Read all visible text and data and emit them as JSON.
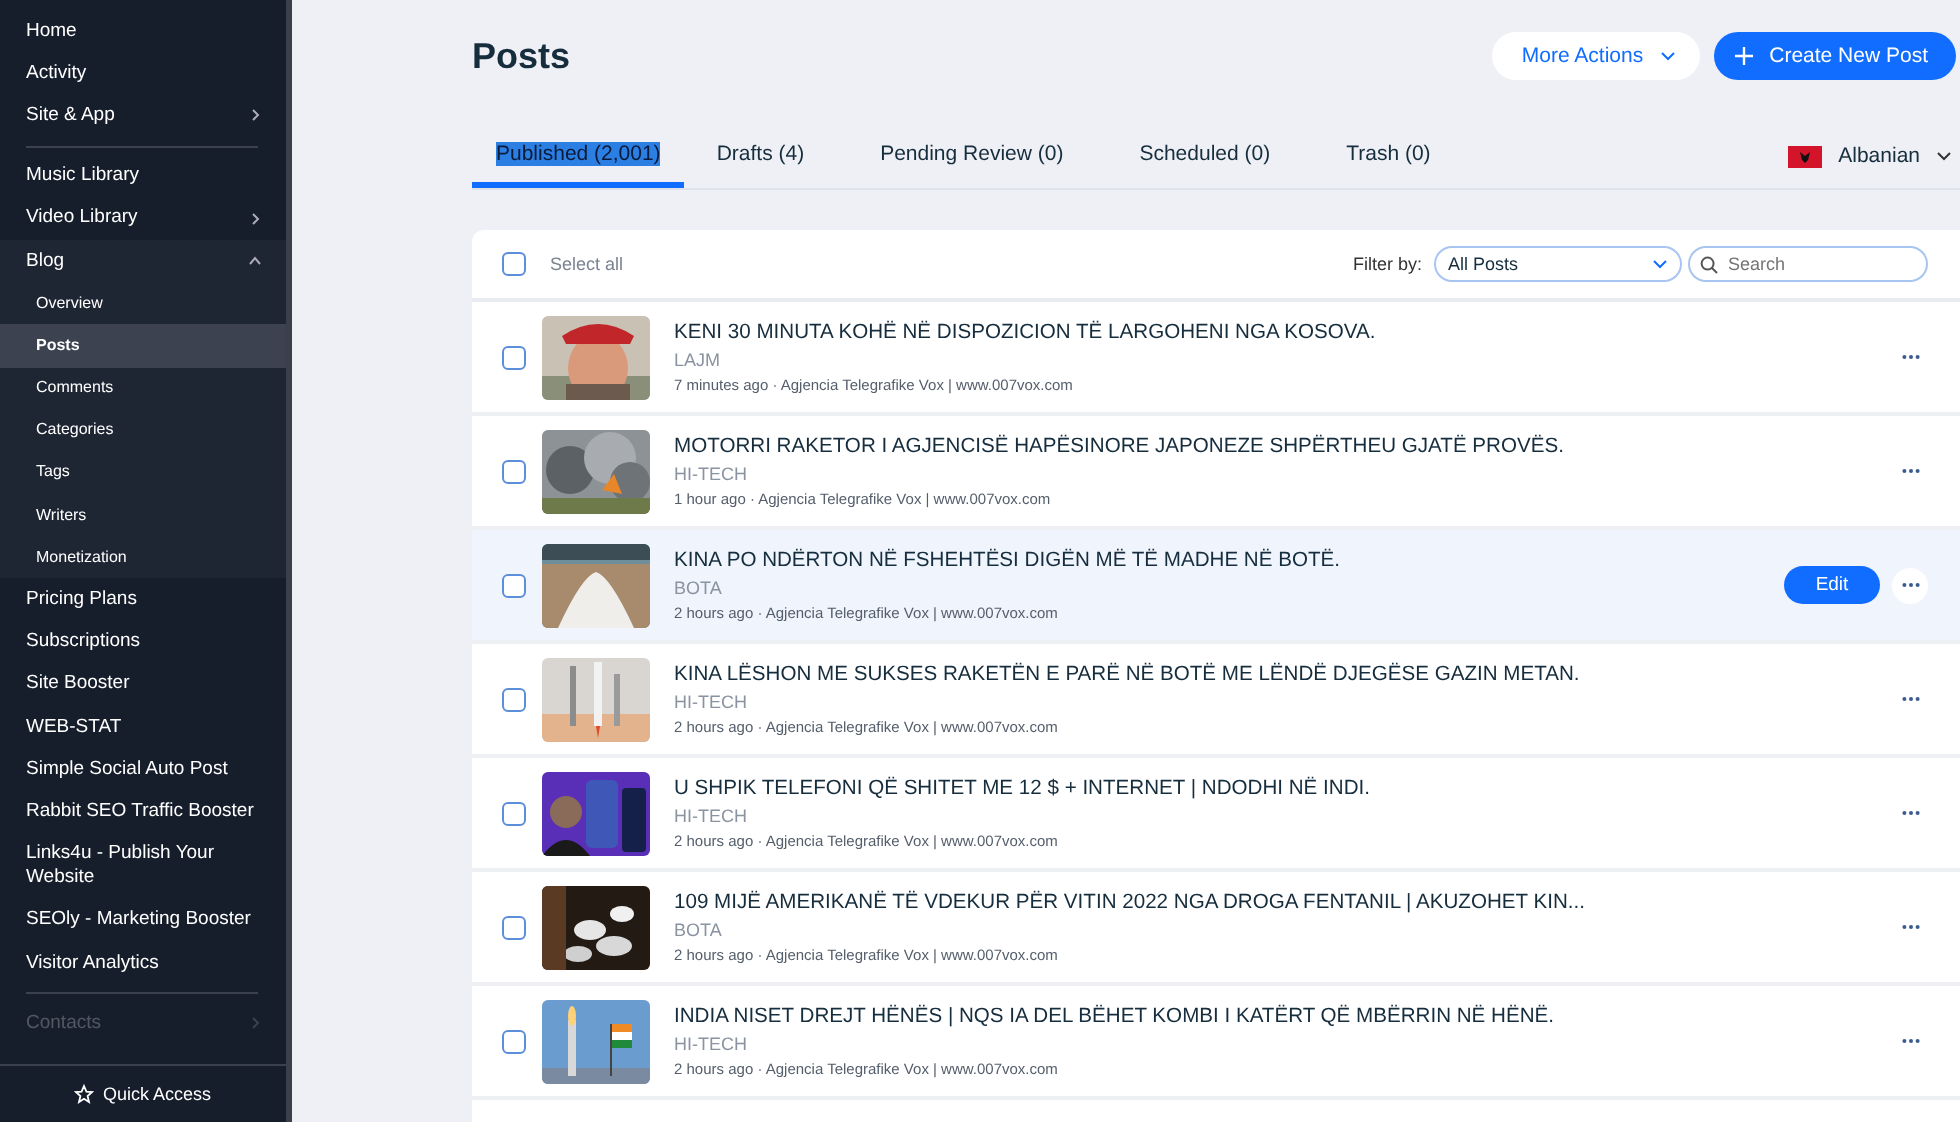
{
  "sidebar": {
    "items": [
      {
        "kind": "link",
        "label": "Home",
        "faded": false
      },
      {
        "kind": "link",
        "label": "Activity",
        "faded": false
      },
      {
        "kind": "group",
        "label": "Site & App",
        "expanded": false,
        "faded": false
      },
      {
        "kind": "divider"
      },
      {
        "kind": "link",
        "label": "Music Library",
        "faded": false
      },
      {
        "kind": "group",
        "label": "Video Library",
        "expanded": false,
        "faded": false
      },
      {
        "kind": "group",
        "label": "Blog",
        "expanded": true,
        "faded": false,
        "children": [
          {
            "label": "Overview",
            "selected": false
          },
          {
            "label": "Posts",
            "selected": true
          },
          {
            "label": "Comments",
            "selected": false
          },
          {
            "label": "Categories",
            "selected": false
          },
          {
            "label": "Tags",
            "selected": false
          },
          {
            "label": "Writers",
            "selected": false
          },
          {
            "label": "Monetization",
            "selected": false
          }
        ]
      },
      {
        "kind": "link",
        "label": "Pricing Plans",
        "faded": false
      },
      {
        "kind": "link",
        "label": "Subscriptions",
        "faded": false
      },
      {
        "kind": "link",
        "label": "Site Booster",
        "faded": false
      },
      {
        "kind": "link",
        "label": "WEB-STAT",
        "faded": false
      },
      {
        "kind": "link",
        "label": "Simple Social Auto Post",
        "faded": false
      },
      {
        "kind": "link",
        "label": "Rabbit SEO Traffic Booster",
        "faded": false
      },
      {
        "kind": "link",
        "label": "Links4u - Publish Your Website",
        "faded": false
      },
      {
        "kind": "link",
        "label": "SEOly - Marketing Booster",
        "faded": false
      },
      {
        "kind": "link",
        "label": "Visitor Analytics",
        "faded": false
      },
      {
        "kind": "divider"
      },
      {
        "kind": "group",
        "label": "Contacts",
        "expanded": false,
        "faded": true
      }
    ],
    "footer": "Quick Access"
  },
  "page": {
    "title": "Posts",
    "more_actions": "More Actions",
    "create_button": "Create New Post"
  },
  "tabs": [
    {
      "label": "Published (2,001)",
      "selected": true
    },
    {
      "label": "Drafts (4)",
      "selected": false
    },
    {
      "label": "Pending Review (0)",
      "selected": false
    },
    {
      "label": "Scheduled (0)",
      "selected": false
    },
    {
      "label": "Trash (0)",
      "selected": false
    }
  ],
  "language": {
    "label": "Albanian"
  },
  "toolbar": {
    "select_all": "Select all",
    "select_all_checked": false,
    "filter_label": "Filter by:",
    "filter_value": "All Posts",
    "search_placeholder": "Search"
  },
  "edit_label": "Edit",
  "posts": [
    {
      "title": "KENI 30 MINUTA KOHË NË DISPOZICION TË LARGOHENI NGA KOSOVA.",
      "category": "LAJM",
      "meta": "7 minutes ago · Agjencia Telegrafike Vox | www.007vox.com",
      "checked": false,
      "hovered": false
    },
    {
      "title": "MOTORRI RAKETOR I AGJENCISË HAPËSINORE JAPONEZE SHPËRTHEU GJATË PROVËS.",
      "category": "HI-TECH",
      "meta": "1 hour ago · Agjencia Telegrafike Vox | www.007vox.com",
      "checked": false,
      "hovered": false
    },
    {
      "title": "KINA PO NDËRTON NË FSHEHTËSI DIGËN MË TË MADHE NË BOTË.",
      "category": "BOTA",
      "meta": "2 hours ago · Agjencia Telegrafike Vox | www.007vox.com",
      "checked": false,
      "hovered": true
    },
    {
      "title": "KINA LËSHON ME SUKSES RAKETËN E PARË NË BOTË ME LËNDË DJEGËSE GAZIN METAN.",
      "category": "HI-TECH",
      "meta": "2 hours ago · Agjencia Telegrafike Vox | www.007vox.com",
      "checked": false,
      "hovered": false
    },
    {
      "title": "U SHPIK TELEFONI QË SHITET ME 12 $ + INTERNET | NDODHI NË INDI.",
      "category": "HI-TECH",
      "meta": "2 hours ago · Agjencia Telegrafike Vox | www.007vox.com",
      "checked": false,
      "hovered": false
    },
    {
      "title": "109 MIJË AMERIKANË TË VDEKUR PËR VITIN 2022 NGA DROGA FENTANIL | AKUZOHET KIN...",
      "category": "BOTA",
      "meta": "2 hours ago · Agjencia Telegrafike Vox | www.007vox.com",
      "checked": false,
      "hovered": false
    },
    {
      "title": "INDIA NISET DREJT HËNËS | NQS IA DEL BËHET KOMBI I KATËRT QË MBËRRIN NË HËNË.",
      "category": "HI-TECH",
      "meta": "2 hours ago · Agjencia Telegrafike Vox | www.007vox.com",
      "checked": false,
      "hovered": false
    }
  ]
}
